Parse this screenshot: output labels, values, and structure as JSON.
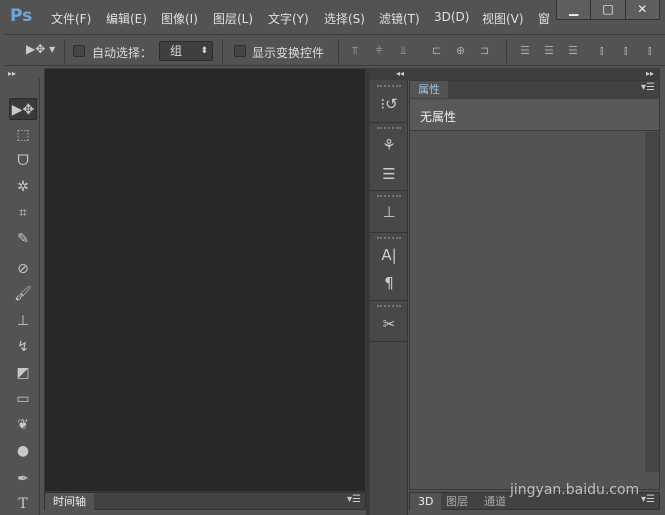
{
  "app": {
    "logo": "Ps"
  },
  "menu": [
    "文件(F)",
    "编辑(E)",
    "图像(I)",
    "图层(L)",
    "文字(Y)",
    "选择(S)",
    "滤镜(T)",
    "3D(D)",
    "视图(V)",
    "窗"
  ],
  "window_controls": {
    "minimize": "▁",
    "maximize": "□",
    "close": "✕"
  },
  "options": {
    "auto_select_label": "自动选择：",
    "auto_select_checked": false,
    "auto_select_value": "组",
    "show_transform_label": "显示变换控件",
    "show_transform_checked": false
  },
  "tools": [
    {
      "name": "move-tool",
      "glyph": "▶✥"
    },
    {
      "name": "marquee-tool",
      "glyph": "⬚"
    },
    {
      "name": "lasso-tool",
      "glyph": "ᗜ"
    },
    {
      "name": "magic-wand-tool",
      "glyph": "✲"
    },
    {
      "name": "crop-tool",
      "glyph": "⌗"
    },
    {
      "name": "eyedropper-tool",
      "glyph": "✎"
    },
    {
      "name": "healing-brush-tool",
      "glyph": "⊘"
    },
    {
      "name": "brush-tool",
      "glyph": "🖌"
    },
    {
      "name": "clone-stamp-tool",
      "glyph": "⊥"
    },
    {
      "name": "history-brush-tool",
      "glyph": "↯"
    },
    {
      "name": "eraser-tool",
      "glyph": "◩"
    },
    {
      "name": "gradient-tool",
      "glyph": "▭"
    },
    {
      "name": "blur-tool",
      "glyph": "❦"
    },
    {
      "name": "dodge-tool",
      "glyph": "●"
    },
    {
      "name": "pen-tool",
      "glyph": "✒"
    },
    {
      "name": "type-tool",
      "glyph": "T"
    }
  ],
  "panel_icons": [
    {
      "name": "history-icon",
      "glyph": "⁝↺"
    },
    {
      "name": "brush-presets-icon",
      "glyph": "⚘"
    },
    {
      "name": "adjust-icon",
      "glyph": "☰"
    },
    {
      "name": "clone-source-icon",
      "glyph": "⊥"
    },
    {
      "name": "character-icon",
      "glyph": "A|"
    },
    {
      "name": "paragraph-icon",
      "glyph": "¶"
    },
    {
      "name": "tool-presets-icon",
      "glyph": "✂"
    }
  ],
  "properties": {
    "tab": "属性",
    "content": "无属性"
  },
  "timeline": {
    "tab": "时间轴"
  },
  "bottom_tabs": [
    "3D",
    "图层",
    "通道"
  ],
  "watermark": "jingyan.baidu.com"
}
